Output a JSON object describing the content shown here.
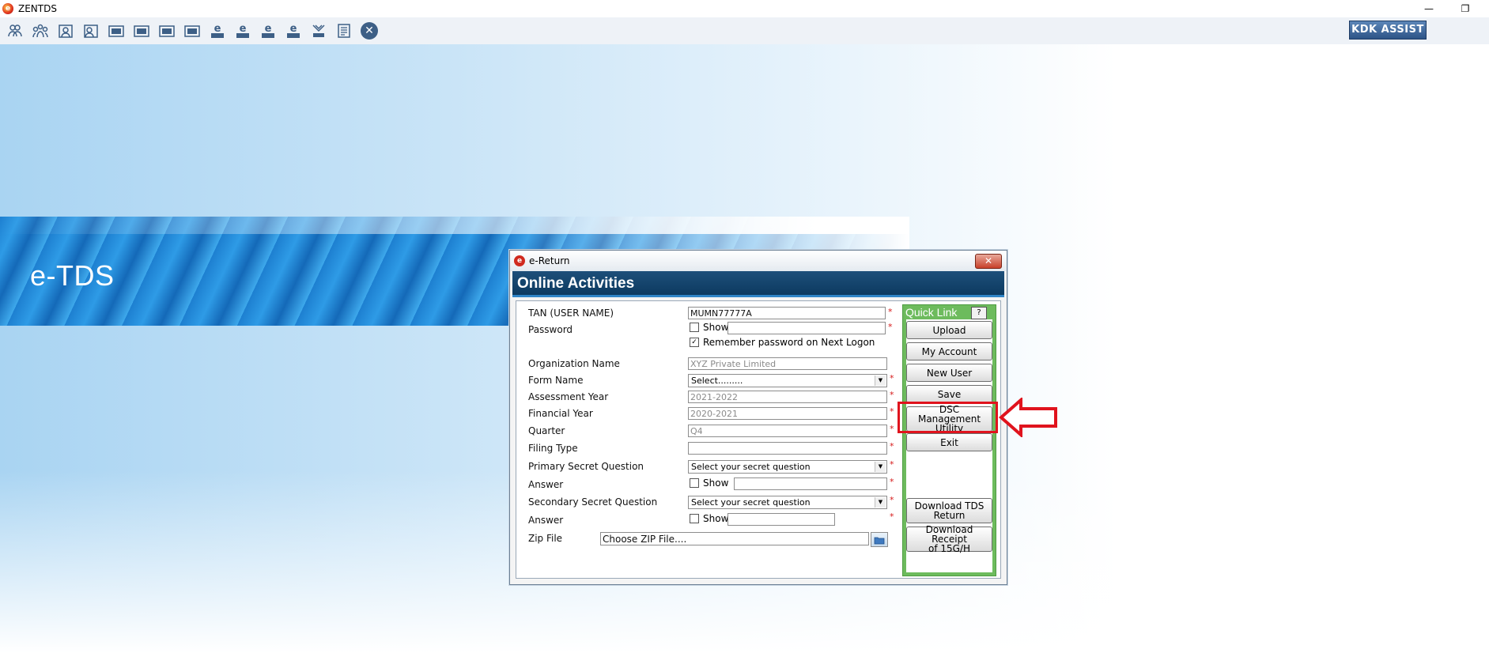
{
  "window": {
    "title": "ZENTDS",
    "app_icon_glyph": "e",
    "minimize_glyph": "—",
    "restore_glyph": "❐"
  },
  "toolbar": {
    "icons": [
      "users-icon",
      "group-icon",
      "user-form-icon",
      "user-edit-icon",
      "form-24q-icon",
      "form-26q-icon",
      "form-27q-icon",
      "form-27eq-icon",
      "etds-24q-icon",
      "etds-26q-icon",
      "etds-27q-icon",
      "etds-27eq-icon",
      "tds-logo-icon",
      "document-icon"
    ],
    "close_glyph": "✕",
    "kdk_assist_label": "KDK ASSIST"
  },
  "banner": {
    "label": "e-TDS"
  },
  "dialog": {
    "title": "e-Return",
    "app_icon_glyph": "e",
    "close_glyph": "✕",
    "header": "Online Activities",
    "fields": {
      "tan_label": "TAN (USER NAME)",
      "tan_value": "MUMN77777A",
      "password_label": "Password",
      "password_show_label": "Show",
      "remember_label": "Remember password on Next Logon",
      "org_label": "Organization Name",
      "org_value": "XYZ Private Limited",
      "form_label": "Form Name",
      "form_value": "Select.........",
      "ay_label": "Assessment Year",
      "ay_value": "2021-2022",
      "fy_label": "Financial Year",
      "fy_value": "2020-2021",
      "quarter_label": "Quarter",
      "quarter_value": "Q4",
      "filing_label": "Filing Type",
      "filing_value": "",
      "psq_label": "Primary Secret Question",
      "psq_value": "Select your secret question",
      "answer1_label": "Answer",
      "answer1_show_label": "Show",
      "ssq_label": "Secondary Secret Question",
      "ssq_value": "Select your secret question",
      "answer2_label": "Answer",
      "answer2_show_label": "Show",
      "zip_label": "Zip File",
      "zip_value": "Choose ZIP File....",
      "required_mark": "*",
      "remember_checked_glyph": "✓",
      "dropdown_arrow": "▼"
    },
    "quick_link": {
      "title": "Quick Link",
      "help_label": "?",
      "buttons": {
        "upload": "Upload",
        "my_account": "My Account",
        "new_user": "New User",
        "save": "Save",
        "dsc_line1": "DSC Management",
        "dsc_line2": "Utility",
        "exit": "Exit",
        "download_tds_line1": "Download TDS",
        "download_tds_line2": "Return",
        "download_receipt_line1": "Download Receipt",
        "download_receipt_line2": "of 15G/H"
      }
    }
  },
  "annotation": {
    "highlight_color": "#e0131d"
  }
}
